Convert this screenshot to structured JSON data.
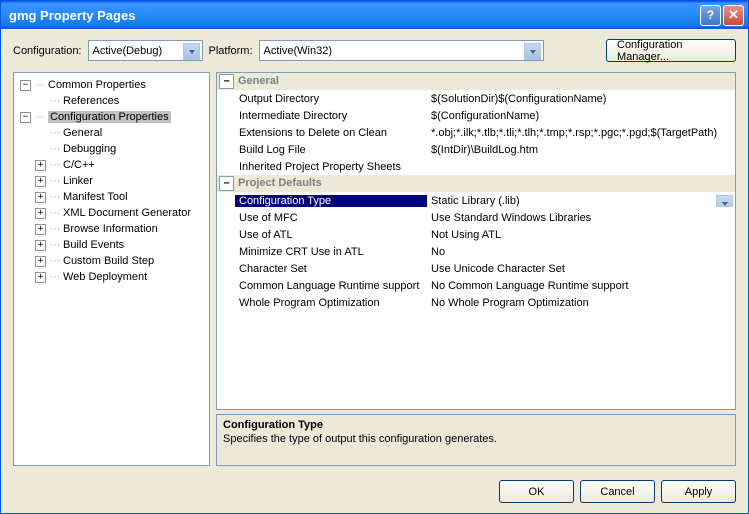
{
  "title": "gmg Property Pages",
  "toolbar": {
    "config_label": "Configuration:",
    "config_value": "Active(Debug)",
    "platform_label": "Platform:",
    "platform_value": "Active(Win32)",
    "cfg_manager": "Configuration Manager..."
  },
  "tree": {
    "common": "Common Properties",
    "references": "References",
    "config_props": "Configuration Properties",
    "general": "General",
    "debugging": "Debugging",
    "cpp": "C/C++",
    "linker": "Linker",
    "manifest": "Manifest Tool",
    "xml": "XML Document Generator",
    "browse": "Browse Information",
    "build_events": "Build Events",
    "custom_build": "Custom Build Step",
    "web_deploy": "Web Deployment"
  },
  "grid": {
    "cat_general": "General",
    "cat_defaults": "Project Defaults",
    "rows_general": [
      {
        "name": "Output Directory",
        "val": "$(SolutionDir)$(ConfigurationName)"
      },
      {
        "name": "Intermediate Directory",
        "val": "$(ConfigurationName)"
      },
      {
        "name": "Extensions to Delete on Clean",
        "val": "*.obj;*.ilk;*.tlb;*.tli;*.tlh;*.tmp;*.rsp;*.pgc;*.pgd;$(TargetPath)"
      },
      {
        "name": "Build Log File",
        "val": "$(IntDir)\\BuildLog.htm"
      },
      {
        "name": "Inherited Project Property Sheets",
        "val": ""
      }
    ],
    "rows_defaults": [
      {
        "name": "Configuration Type",
        "val": "Static Library (.lib)",
        "selected": true
      },
      {
        "name": "Use of MFC",
        "val": "Use Standard Windows Libraries"
      },
      {
        "name": "Use of ATL",
        "val": "Not Using ATL"
      },
      {
        "name": "Minimize CRT Use in ATL",
        "val": "No"
      },
      {
        "name": "Character Set",
        "val": "Use Unicode Character Set"
      },
      {
        "name": "Common Language Runtime support",
        "val": "No Common Language Runtime support"
      },
      {
        "name": "Whole Program Optimization",
        "val": "No Whole Program Optimization"
      }
    ]
  },
  "desc": {
    "title": "Configuration Type",
    "text": "Specifies the type of output this configuration generates."
  },
  "footer": {
    "ok": "OK",
    "cancel": "Cancel",
    "apply": "Apply"
  }
}
